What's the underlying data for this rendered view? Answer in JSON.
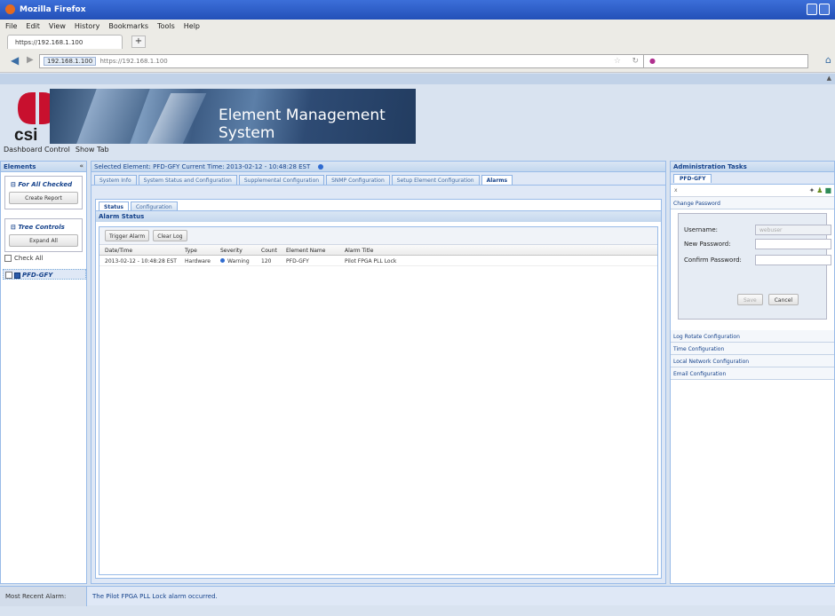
{
  "window": {
    "title": "Mozilla Firefox"
  },
  "menu": [
    "File",
    "Edit",
    "View",
    "History",
    "Bookmarks",
    "Tools",
    "Help"
  ],
  "browser_tab": {
    "label": "https://192.168.1.100"
  },
  "urlbar": {
    "site": "192.168.1.100",
    "url": "https://192.168.1.100"
  },
  "banner": {
    "logo_text": "csi",
    "title": "Element Management System"
  },
  "topnav": {
    "dashboard": "Dashboard Control",
    "show_tab": "Show Tab"
  },
  "left": {
    "title": "Elements",
    "for_all_checked": "For All Checked",
    "create_report": "Create Report",
    "tree_controls": "Tree Controls",
    "expand_all": "Expand All",
    "check_all": "Check All",
    "tree_item": "PFD-GFY"
  },
  "center": {
    "selected_label": "Selected Element:",
    "selected_element": "PFD-GFY",
    "current_time_label": "Current Time:",
    "current_time": "2013-02-12 - 10:48:28 EST",
    "tabs": [
      "System Info",
      "System Status and Configuration",
      "Supplemental Configuration",
      "SNMP Configuration",
      "Setup Element Configuration",
      "Alarms"
    ],
    "subtabs": [
      "Status",
      "Configuration"
    ],
    "alarm_status_title": "Alarm Status",
    "trigger_alarm": "Trigger Alarm",
    "clear_log": "Clear Log",
    "columns": [
      "Date/Time",
      "Type",
      "Severity",
      "Count",
      "Element Name",
      "Alarm Title"
    ],
    "rows": [
      {
        "datetime": "2013-02-12 - 10:48:28 EST",
        "type": "Hardware",
        "severity": "Warning",
        "count": "120",
        "element": "PFD-GFY",
        "title": "Pilot FPGA PLL Lock"
      }
    ]
  },
  "right": {
    "title": "Administration Tasks",
    "tab": "PFD-GFY",
    "change_password": "Change Password",
    "username_label": "Username:",
    "username_value": "webuser",
    "new_password_label": "New Password:",
    "confirm_password_label": "Confirm Password:",
    "save": "Save",
    "cancel": "Cancel",
    "sections": [
      "Log Rotate Configuration",
      "Time Configuration",
      "Local Network Configuration",
      "Email Configuration"
    ]
  },
  "status": {
    "label": "Most Recent Alarm:",
    "message": "The Pilot FPGA PLL Lock alarm occurred."
  },
  "colors": {
    "accent": "#15428b",
    "panel_border": "#99bbe8",
    "title_bar": "#2350b8"
  }
}
